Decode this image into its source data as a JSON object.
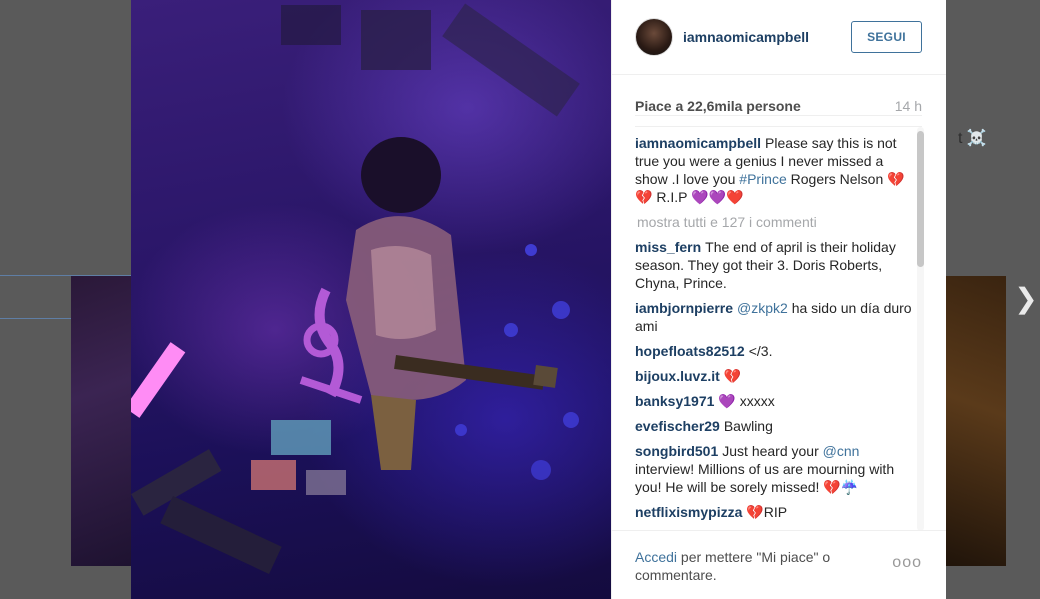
{
  "background": {
    "side_text": "t ☠️"
  },
  "modal": {
    "header": {
      "username": "iamnaomicampbell",
      "follow_label": "SEGUI"
    },
    "likes": "Piace a 22,6mila persone",
    "time": "14 h",
    "caption": {
      "user": "iamnaomicampbell",
      "text_before": "Please say this is not true you were a genius I never missed a show .I love you ",
      "hashtag": "#Prince",
      "text_after": " Rogers Nelson 💔💔 R.I.P 💜💜❤️"
    },
    "show_all": "mostra tutti e 127 i commenti",
    "comments": [
      {
        "user": "miss_fern",
        "text": "The end of april is their holiday season. They got their 3. Doris Roberts, Chyna, Prince."
      },
      {
        "user": "iambjornpierre",
        "mention": "@zkpk2",
        "text": " ha sido un día duro ami"
      },
      {
        "user": "hopefloats82512",
        "text": "</3."
      },
      {
        "user": "bijoux.luvz.it",
        "text": "💔"
      },
      {
        "user": "banksy1971",
        "text": "💜 xxxxx"
      },
      {
        "user": "evefischer29",
        "text": "Bawling"
      },
      {
        "user": "songbird501",
        "text_before": "Just heard your ",
        "mention": "@cnn",
        "text": " interview! Millions of us are mourning with you! He will be sorely missed! 💔☔"
      },
      {
        "user": "netflixismypizza",
        "text": "💔RIP"
      }
    ],
    "footer": {
      "login_link": "Accedi",
      "login_rest": " per mettere \"Mi piace\" o commentare.",
      "more": "ooo"
    }
  },
  "colors": {
    "link": "#3f729b",
    "username": "#1d3f63",
    "muted": "#a5a7aa"
  },
  "icons": {
    "next": "chevron-right-icon",
    "more": "more-options-icon"
  }
}
